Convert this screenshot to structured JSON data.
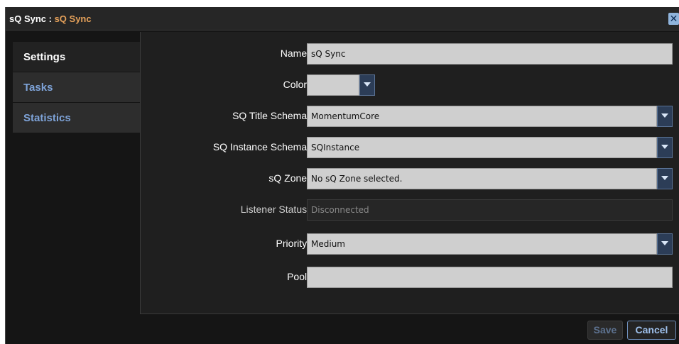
{
  "window": {
    "title_prefix": "sQ Sync : ",
    "title_name": "sQ Sync",
    "close_glyph": "✕"
  },
  "sidebar": {
    "items": [
      {
        "label": "Settings",
        "active": true
      },
      {
        "label": "Tasks",
        "active": false
      },
      {
        "label": "Statistics",
        "active": false
      }
    ]
  },
  "form": {
    "name": {
      "label": "Name:",
      "value": "sQ Sync"
    },
    "color": {
      "label": "Color:",
      "value": ""
    },
    "title_schema": {
      "label": "SQ Title Schema:",
      "value": "MomentumCore"
    },
    "instance_schema": {
      "label": "SQ Instance Schema:",
      "value": "SQInstance"
    },
    "zone": {
      "label": "sQ Zone:",
      "value": "No sQ Zone selected."
    },
    "listener_status": {
      "label": "Listener Status:",
      "value": "Disconnected"
    },
    "priority": {
      "label": "Priority:",
      "value": "Medium"
    },
    "pool": {
      "label": "Pool:",
      "value": ""
    }
  },
  "footer": {
    "save_label": "Save",
    "cancel_label": "Cancel"
  },
  "icons": {
    "dropdown": "chevron-down-icon",
    "close": "close-icon"
  },
  "colors": {
    "accent": "#e5a15a",
    "link": "#7ea3d8",
    "background": "#151515"
  }
}
